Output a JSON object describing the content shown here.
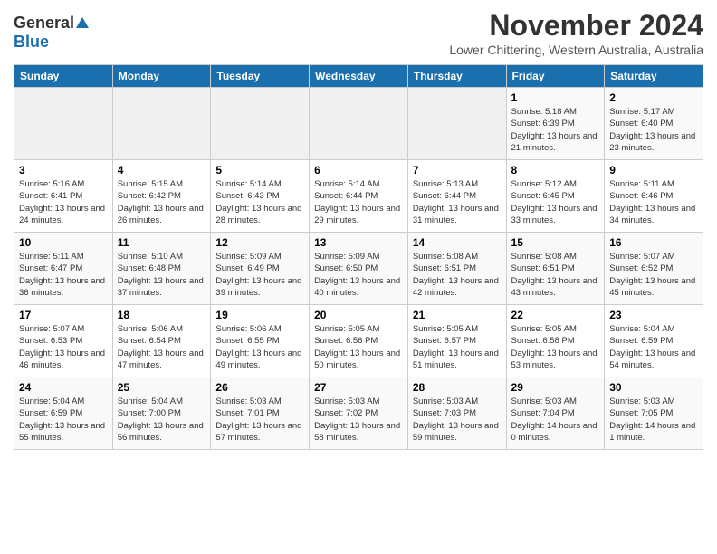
{
  "logo": {
    "general": "General",
    "blue": "Blue"
  },
  "header": {
    "month_year": "November 2024",
    "location": "Lower Chittering, Western Australia, Australia"
  },
  "days_of_week": [
    "Sunday",
    "Monday",
    "Tuesday",
    "Wednesday",
    "Thursday",
    "Friday",
    "Saturday"
  ],
  "weeks": [
    [
      {
        "day": "",
        "info": ""
      },
      {
        "day": "",
        "info": ""
      },
      {
        "day": "",
        "info": ""
      },
      {
        "day": "",
        "info": ""
      },
      {
        "day": "",
        "info": ""
      },
      {
        "day": "1",
        "info": "Sunrise: 5:18 AM\nSunset: 6:39 PM\nDaylight: 13 hours\nand 21 minutes."
      },
      {
        "day": "2",
        "info": "Sunrise: 5:17 AM\nSunset: 6:40 PM\nDaylight: 13 hours\nand 23 minutes."
      }
    ],
    [
      {
        "day": "3",
        "info": "Sunrise: 5:16 AM\nSunset: 6:41 PM\nDaylight: 13 hours\nand 24 minutes."
      },
      {
        "day": "4",
        "info": "Sunrise: 5:15 AM\nSunset: 6:42 PM\nDaylight: 13 hours\nand 26 minutes."
      },
      {
        "day": "5",
        "info": "Sunrise: 5:14 AM\nSunset: 6:43 PM\nDaylight: 13 hours\nand 28 minutes."
      },
      {
        "day": "6",
        "info": "Sunrise: 5:14 AM\nSunset: 6:44 PM\nDaylight: 13 hours\nand 29 minutes."
      },
      {
        "day": "7",
        "info": "Sunrise: 5:13 AM\nSunset: 6:44 PM\nDaylight: 13 hours\nand 31 minutes."
      },
      {
        "day": "8",
        "info": "Sunrise: 5:12 AM\nSunset: 6:45 PM\nDaylight: 13 hours\nand 33 minutes."
      },
      {
        "day": "9",
        "info": "Sunrise: 5:11 AM\nSunset: 6:46 PM\nDaylight: 13 hours\nand 34 minutes."
      }
    ],
    [
      {
        "day": "10",
        "info": "Sunrise: 5:11 AM\nSunset: 6:47 PM\nDaylight: 13 hours\nand 36 minutes."
      },
      {
        "day": "11",
        "info": "Sunrise: 5:10 AM\nSunset: 6:48 PM\nDaylight: 13 hours\nand 37 minutes."
      },
      {
        "day": "12",
        "info": "Sunrise: 5:09 AM\nSunset: 6:49 PM\nDaylight: 13 hours\nand 39 minutes."
      },
      {
        "day": "13",
        "info": "Sunrise: 5:09 AM\nSunset: 6:50 PM\nDaylight: 13 hours\nand 40 minutes."
      },
      {
        "day": "14",
        "info": "Sunrise: 5:08 AM\nSunset: 6:51 PM\nDaylight: 13 hours\nand 42 minutes."
      },
      {
        "day": "15",
        "info": "Sunrise: 5:08 AM\nSunset: 6:51 PM\nDaylight: 13 hours\nand 43 minutes."
      },
      {
        "day": "16",
        "info": "Sunrise: 5:07 AM\nSunset: 6:52 PM\nDaylight: 13 hours\nand 45 minutes."
      }
    ],
    [
      {
        "day": "17",
        "info": "Sunrise: 5:07 AM\nSunset: 6:53 PM\nDaylight: 13 hours\nand 46 minutes."
      },
      {
        "day": "18",
        "info": "Sunrise: 5:06 AM\nSunset: 6:54 PM\nDaylight: 13 hours\nand 47 minutes."
      },
      {
        "day": "19",
        "info": "Sunrise: 5:06 AM\nSunset: 6:55 PM\nDaylight: 13 hours\nand 49 minutes."
      },
      {
        "day": "20",
        "info": "Sunrise: 5:05 AM\nSunset: 6:56 PM\nDaylight: 13 hours\nand 50 minutes."
      },
      {
        "day": "21",
        "info": "Sunrise: 5:05 AM\nSunset: 6:57 PM\nDaylight: 13 hours\nand 51 minutes."
      },
      {
        "day": "22",
        "info": "Sunrise: 5:05 AM\nSunset: 6:58 PM\nDaylight: 13 hours\nand 53 minutes."
      },
      {
        "day": "23",
        "info": "Sunrise: 5:04 AM\nSunset: 6:59 PM\nDaylight: 13 hours\nand 54 minutes."
      }
    ],
    [
      {
        "day": "24",
        "info": "Sunrise: 5:04 AM\nSunset: 6:59 PM\nDaylight: 13 hours\nand 55 minutes."
      },
      {
        "day": "25",
        "info": "Sunrise: 5:04 AM\nSunset: 7:00 PM\nDaylight: 13 hours\nand 56 minutes."
      },
      {
        "day": "26",
        "info": "Sunrise: 5:03 AM\nSunset: 7:01 PM\nDaylight: 13 hours\nand 57 minutes."
      },
      {
        "day": "27",
        "info": "Sunrise: 5:03 AM\nSunset: 7:02 PM\nDaylight: 13 hours\nand 58 minutes."
      },
      {
        "day": "28",
        "info": "Sunrise: 5:03 AM\nSunset: 7:03 PM\nDaylight: 13 hours\nand 59 minutes."
      },
      {
        "day": "29",
        "info": "Sunrise: 5:03 AM\nSunset: 7:04 PM\nDaylight: 14 hours\nand 0 minutes."
      },
      {
        "day": "30",
        "info": "Sunrise: 5:03 AM\nSunset: 7:05 PM\nDaylight: 14 hours\nand 1 minute."
      }
    ]
  ]
}
